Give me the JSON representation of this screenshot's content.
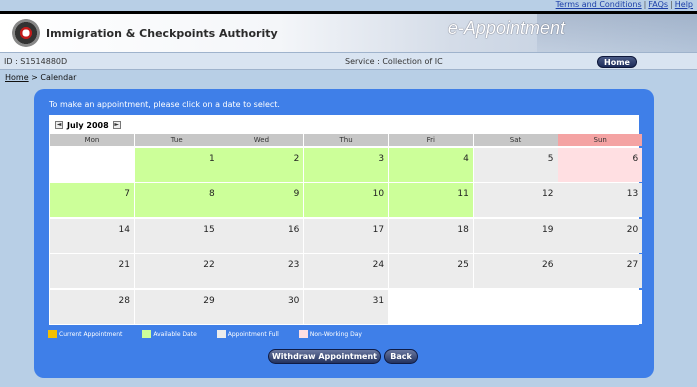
{
  "top_links": [
    "Terms and Conditions",
    "FAQs",
    "Help"
  ],
  "header": {
    "agency": "Immigration & Checkpoints Authority",
    "app_title": "e-Appointment"
  },
  "idbar": {
    "id": "ID : S1514880D",
    "service": "Service : Collection of IC",
    "home_label": "Home"
  },
  "breadcrumb": {
    "home": "Home",
    "separator": ">",
    "current": "Calendar"
  },
  "instruction": "To make an appointment, please click on a date to select.",
  "calendar": {
    "month_label": "July 2008",
    "prev_icon": "◄",
    "next_icon": "►",
    "weekdays": [
      "Mon",
      "Tue",
      "Wed",
      "Thu",
      "Fri",
      "Sat",
      "Sun"
    ],
    "weeks": [
      [
        {
          "d": "",
          "s": "empty"
        },
        {
          "d": "1",
          "s": "avail"
        },
        {
          "d": "2",
          "s": "avail"
        },
        {
          "d": "3",
          "s": "avail"
        },
        {
          "d": "4",
          "s": "avail"
        },
        {
          "d": "5",
          "s": "full"
        },
        {
          "d": "6",
          "s": "nonwork"
        }
      ],
      [
        {
          "d": "7",
          "s": "avail"
        },
        {
          "d": "8",
          "s": "avail"
        },
        {
          "d": "9",
          "s": "avail"
        },
        {
          "d": "10",
          "s": "avail"
        },
        {
          "d": "11",
          "s": "avail"
        },
        {
          "d": "12",
          "s": "full"
        },
        {
          "d": "13",
          "s": "full"
        }
      ],
      [
        {
          "d": "14",
          "s": "full"
        },
        {
          "d": "15",
          "s": "full"
        },
        {
          "d": "16",
          "s": "full"
        },
        {
          "d": "17",
          "s": "full"
        },
        {
          "d": "18",
          "s": "full"
        },
        {
          "d": "19",
          "s": "full"
        },
        {
          "d": "20",
          "s": "full"
        }
      ],
      [
        {
          "d": "21",
          "s": "full"
        },
        {
          "d": "22",
          "s": "full"
        },
        {
          "d": "23",
          "s": "full"
        },
        {
          "d": "24",
          "s": "full"
        },
        {
          "d": "25",
          "s": "full"
        },
        {
          "d": "26",
          "s": "full"
        },
        {
          "d": "27",
          "s": "full"
        }
      ],
      [
        {
          "d": "28",
          "s": "full"
        },
        {
          "d": "29",
          "s": "full"
        },
        {
          "d": "30",
          "s": "full"
        },
        {
          "d": "31",
          "s": "full"
        },
        {
          "d": "",
          "s": "empty"
        },
        {
          "d": "",
          "s": "empty"
        },
        {
          "d": "",
          "s": "empty"
        }
      ]
    ]
  },
  "legend": [
    {
      "label": "Current Appointment",
      "color": "#f5c000"
    },
    {
      "label": "Available Date",
      "color": "#ccff99"
    },
    {
      "label": "Appointment Full",
      "color": "#ececec"
    },
    {
      "label": "Non-Working Day",
      "color": "#ffdfe2"
    }
  ],
  "buttons": {
    "withdraw": "Withdraw Appointment",
    "back": "Back"
  },
  "colors": {
    "panel": "#3f7fe8",
    "available": "#ccff99",
    "nonworking": "#ffdfe2",
    "sunday_header": "#f4a3a3"
  }
}
